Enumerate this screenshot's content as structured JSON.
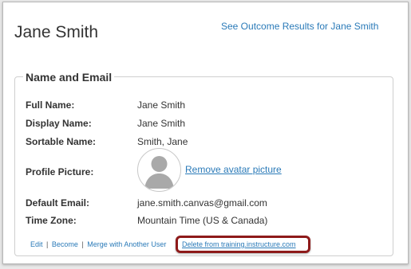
{
  "header": {
    "title": "Jane Smith",
    "outcome_link": "See Outcome Results for Jane Smith"
  },
  "section": {
    "legend": "Name and Email",
    "rows": [
      {
        "label": "Full Name:",
        "value": "Jane Smith"
      },
      {
        "label": "Display Name:",
        "value": "Jane Smith"
      },
      {
        "label": "Sortable Name:",
        "value": "Smith, Jane"
      },
      {
        "label": "Profile Picture:",
        "value": ""
      },
      {
        "label": "Default Email:",
        "value": "jane.smith.canvas@gmail.com"
      },
      {
        "label": "Time Zone:",
        "value": "Mountain Time (US & Canada)"
      }
    ],
    "avatar_icon": "user-silhouette-icon",
    "remove_avatar": "Remove avatar picture"
  },
  "actions": {
    "edit": "Edit",
    "become": "Become",
    "merge": "Merge with Another User",
    "separator": "|",
    "delete": "Delete from training.instructure.com"
  },
  "colors": {
    "link": "#2a7ab8",
    "highlight": "#8e1a1a"
  }
}
